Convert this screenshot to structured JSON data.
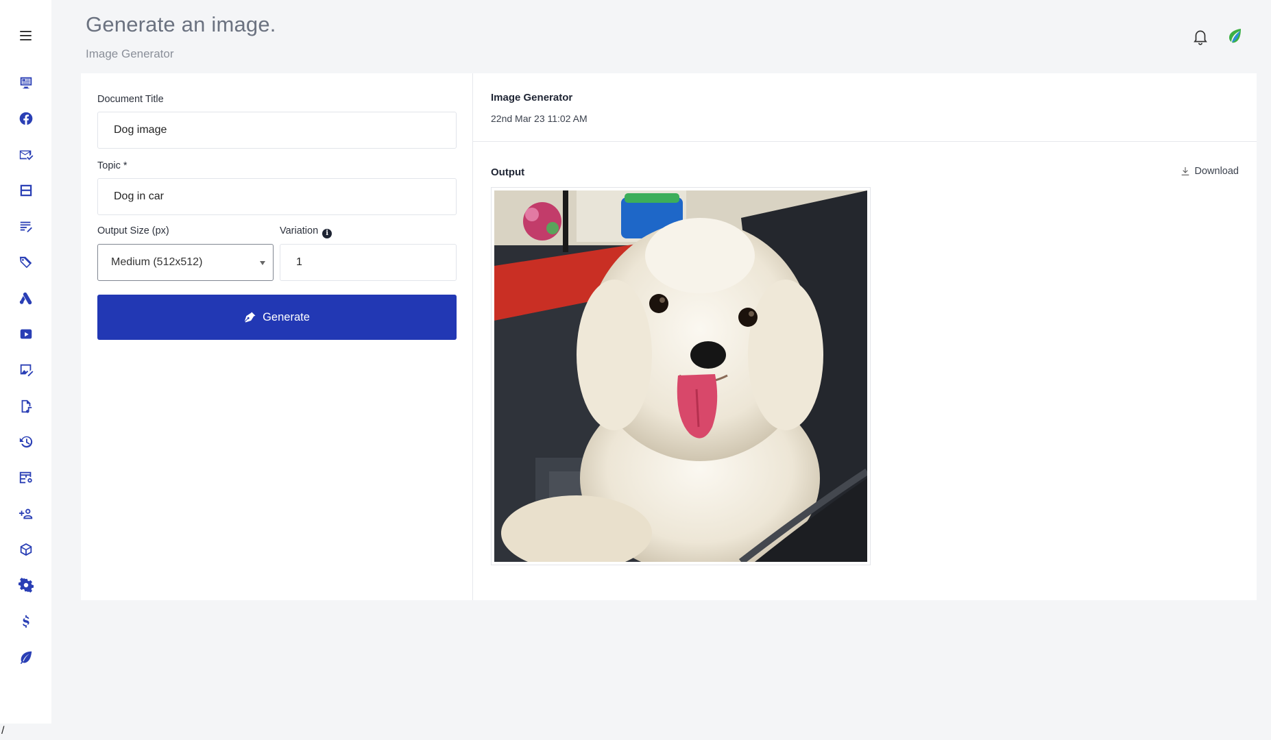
{
  "header": {
    "title": "Generate an image.",
    "subtitle": "Image Generator"
  },
  "sidebar": {
    "items": [
      {
        "name": "sidebar-item-dashboard",
        "icon": "monitor-icon"
      },
      {
        "name": "sidebar-item-facebook",
        "icon": "facebook-icon"
      },
      {
        "name": "sidebar-item-email",
        "icon": "email-check-icon"
      },
      {
        "name": "sidebar-item-layout",
        "icon": "layout-icon"
      },
      {
        "name": "sidebar-item-document",
        "icon": "document-edit-icon"
      },
      {
        "name": "sidebar-item-tags",
        "icon": "tag-icon"
      },
      {
        "name": "sidebar-item-ads",
        "icon": "google-ads-icon"
      },
      {
        "name": "sidebar-item-youtube",
        "icon": "youtube-icon"
      },
      {
        "name": "sidebar-item-image-edit",
        "icon": "image-edit-icon"
      },
      {
        "name": "sidebar-item-audio",
        "icon": "audio-file-icon"
      },
      {
        "name": "sidebar-item-history",
        "icon": "history-icon"
      },
      {
        "name": "sidebar-item-table-settings",
        "icon": "table-settings-icon"
      },
      {
        "name": "sidebar-item-add-user",
        "icon": "add-user-icon"
      },
      {
        "name": "sidebar-item-package",
        "icon": "package-icon"
      },
      {
        "name": "sidebar-item-settings",
        "icon": "gear-icon"
      },
      {
        "name": "sidebar-item-billing",
        "icon": "dollar-icon"
      },
      {
        "name": "sidebar-item-brand",
        "icon": "leaf-icon"
      }
    ],
    "footer_text": "/"
  },
  "form": {
    "document_title_label": "Document Title",
    "document_title_value": "Dog image",
    "topic_label": "Topic *",
    "topic_value": "Dog in car",
    "output_size_label": "Output Size (px)",
    "output_size_value": "Medium (512x512)",
    "variation_label": "Variation",
    "variation_value": "1",
    "generate_label": "Generate"
  },
  "output": {
    "panel_title": "Image Generator",
    "timestamp": "22nd Mar 23 11:02 AM",
    "output_label": "Output",
    "download_label": "Download"
  },
  "colors": {
    "accent": "#2238b4",
    "sidebar_icon": "#2a3fb5",
    "background": "#f4f5f7"
  }
}
